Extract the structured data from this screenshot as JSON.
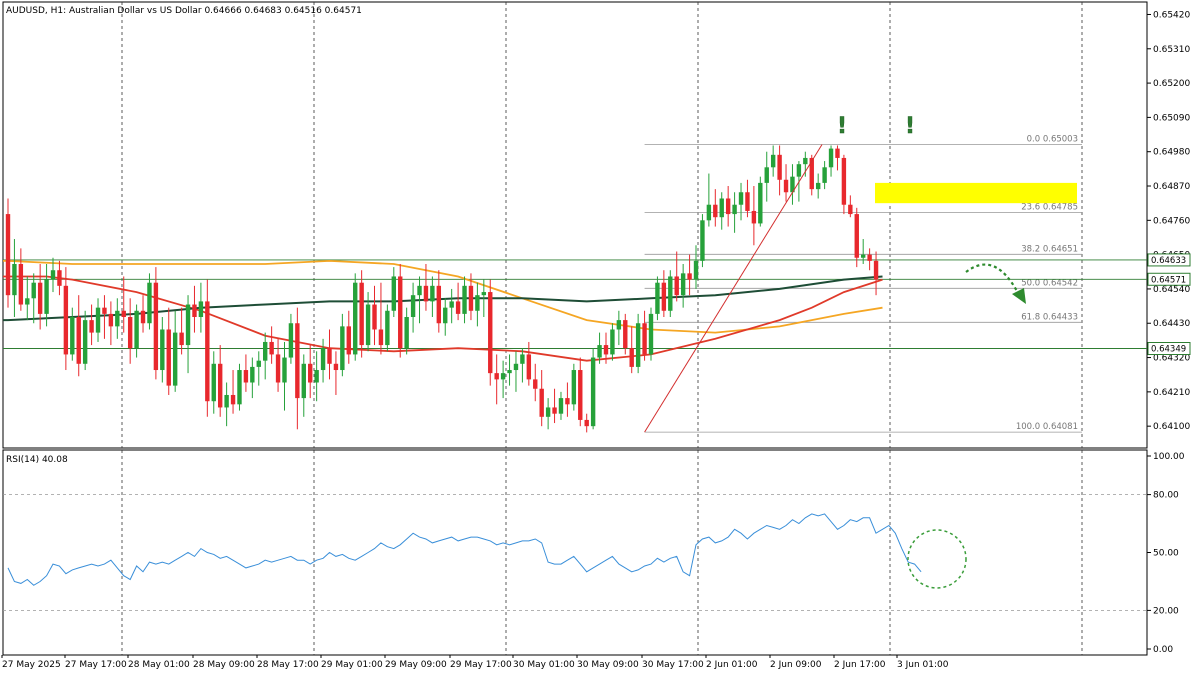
{
  "header": {
    "text": "AUDUSD, H1:  Australian Dollar vs US Dollar  0.64666 0.64683 0.64516 0.64571"
  },
  "rsi_label": "RSI(14) 40.08",
  "colors": {
    "bull": "#26a13a",
    "bear": "#e8282d",
    "ema50": "#e03a2a",
    "ema100": "#f5a623",
    "ema200": "#1e4d36",
    "rsi": "#3a8fd9",
    "fib": "#999999",
    "hline": "#2e7d32",
    "highlight": "#ffff00",
    "arrow": "#2e8b2e",
    "circle": "#3a9d3a"
  },
  "chart_data": [
    {
      "type": "candlestick",
      "symbol": "AUDUSD",
      "timeframe": "H1",
      "ylim": [
        0.6403,
        0.6546
      ],
      "y_ticks": [
        "0.65420",
        "0.65310",
        "0.65200",
        "0.65090",
        "0.64980",
        "0.64870",
        "0.64760",
        "0.64650",
        "0.64540",
        "0.64430",
        "0.64320",
        "0.64210",
        "0.64100"
      ],
      "x_ticks": [
        "27 May 2025",
        "27 May 17:00",
        "28 May 01:00",
        "28 May 09:00",
        "28 May 17:00",
        "29 May 01:00",
        "29 May 09:00",
        "29 May 17:00",
        "30 May 01:00",
        "30 May 09:00",
        "30 May 17:00",
        "2 Jun 01:00",
        "2 Jun 09:00",
        "2 Jun 17:00",
        "3 Jun 01:00"
      ],
      "price_tags": [
        {
          "label": "0.64633",
          "value": 0.64633
        },
        {
          "label": "0.64571",
          "value": 0.64571
        },
        {
          "label": "0.64349",
          "value": 0.64349
        }
      ],
      "horizontal_lines": [
        0.64633,
        0.64571,
        0.64349
      ],
      "fibonacci": {
        "from": 0.64081,
        "to": 0.65003,
        "levels": [
          {
            "label": "0.0 0.65003",
            "value": 0.65003
          },
          {
            "label": "23.6 0.64785",
            "value": 0.64785
          },
          {
            "label": "38.2 0.64651",
            "value": 0.64651
          },
          {
            "label": "50.0 0.64542",
            "value": 0.64542
          },
          {
            "label": "61.8 0.64433",
            "value": 0.64433
          },
          {
            "label": "100.0 0.64081",
            "value": 0.64081
          }
        ]
      },
      "highlight_zone": [
        0.64815,
        0.6488
      ],
      "annotations": [
        "!",
        "!"
      ],
      "candles": [
        [
          0.6478,
          0.6483,
          0.6448,
          0.6452
        ],
        [
          0.6452,
          0.647,
          0.6445,
          0.6462
        ],
        [
          0.6462,
          0.6467,
          0.6447,
          0.6449
        ],
        [
          0.6449,
          0.6458,
          0.6444,
          0.6451
        ],
        [
          0.6451,
          0.6459,
          0.6443,
          0.6456
        ],
        [
          0.6456,
          0.6462,
          0.6441,
          0.6446
        ],
        [
          0.6446,
          0.6462,
          0.6442,
          0.6457
        ],
        [
          0.6457,
          0.6464,
          0.6453,
          0.646
        ],
        [
          0.646,
          0.6463,
          0.6452,
          0.6455
        ],
        [
          0.6455,
          0.6461,
          0.6428,
          0.6433
        ],
        [
          0.6433,
          0.6448,
          0.6431,
          0.6445
        ],
        [
          0.6445,
          0.6452,
          0.6426,
          0.643
        ],
        [
          0.643,
          0.6447,
          0.6428,
          0.6444
        ],
        [
          0.6444,
          0.6449,
          0.6436,
          0.644
        ],
        [
          0.644,
          0.6451,
          0.6437,
          0.6448
        ],
        [
          0.6448,
          0.6452,
          0.6438,
          0.6446
        ],
        [
          0.6446,
          0.645,
          0.6436,
          0.6442
        ],
        [
          0.6442,
          0.6451,
          0.6438,
          0.6447
        ],
        [
          0.6447,
          0.6458,
          0.644,
          0.6445
        ],
        [
          0.6445,
          0.6451,
          0.643,
          0.6435
        ],
        [
          0.6435,
          0.6449,
          0.6432,
          0.6447
        ],
        [
          0.6447,
          0.6452,
          0.644,
          0.6443
        ],
        [
          0.6443,
          0.6459,
          0.6441,
          0.6456
        ],
        [
          0.6456,
          0.6461,
          0.6425,
          0.6428
        ],
        [
          0.6428,
          0.6445,
          0.6424,
          0.6441
        ],
        [
          0.6441,
          0.6448,
          0.642,
          0.6423
        ],
        [
          0.6423,
          0.6447,
          0.6421,
          0.644
        ],
        [
          0.644,
          0.6448,
          0.6433,
          0.6436
        ],
        [
          0.6436,
          0.6452,
          0.6427,
          0.6449
        ],
        [
          0.6449,
          0.6455,
          0.644,
          0.6445
        ],
        [
          0.6445,
          0.6456,
          0.644,
          0.645
        ],
        [
          0.645,
          0.6457,
          0.6413,
          0.6418
        ],
        [
          0.6418,
          0.6434,
          0.6414,
          0.643
        ],
        [
          0.643,
          0.6436,
          0.6413,
          0.6416
        ],
        [
          0.6416,
          0.6424,
          0.641,
          0.642
        ],
        [
          0.642,
          0.6428,
          0.6414,
          0.6417
        ],
        [
          0.6417,
          0.643,
          0.6415,
          0.6428
        ],
        [
          0.6428,
          0.6433,
          0.6421,
          0.6424
        ],
        [
          0.6424,
          0.6432,
          0.6419,
          0.6429
        ],
        [
          0.6429,
          0.6434,
          0.6423,
          0.6431
        ],
        [
          0.6431,
          0.644,
          0.6425,
          0.6437
        ],
        [
          0.6437,
          0.6442,
          0.643,
          0.6433
        ],
        [
          0.6433,
          0.6438,
          0.6421,
          0.6424
        ],
        [
          0.6424,
          0.6437,
          0.6415,
          0.6432
        ],
        [
          0.6432,
          0.6446,
          0.643,
          0.6443
        ],
        [
          0.6443,
          0.6448,
          0.6409,
          0.6419
        ],
        [
          0.6419,
          0.6433,
          0.6413,
          0.643
        ],
        [
          0.643,
          0.6436,
          0.6419,
          0.6424
        ],
        [
          0.6424,
          0.6434,
          0.6418,
          0.6428
        ],
        [
          0.6428,
          0.6438,
          0.6424,
          0.6435
        ],
        [
          0.6435,
          0.6441,
          0.6425,
          0.643
        ],
        [
          0.643,
          0.6434,
          0.642,
          0.6428
        ],
        [
          0.6428,
          0.6446,
          0.6426,
          0.6442
        ],
        [
          0.6442,
          0.6447,
          0.643,
          0.6433
        ],
        [
          0.6433,
          0.6459,
          0.6431,
          0.6456
        ],
        [
          0.6456,
          0.646,
          0.6432,
          0.6436
        ],
        [
          0.6436,
          0.6453,
          0.6434,
          0.6449
        ],
        [
          0.6449,
          0.6455,
          0.6436,
          0.6441
        ],
        [
          0.6441,
          0.6456,
          0.6433,
          0.6436
        ],
        [
          0.6436,
          0.6449,
          0.6434,
          0.6447
        ],
        [
          0.6447,
          0.6461,
          0.6445,
          0.6458
        ],
        [
          0.6458,
          0.6462,
          0.6432,
          0.6435
        ],
        [
          0.6435,
          0.6448,
          0.6433,
          0.6445
        ],
        [
          0.6445,
          0.6456,
          0.644,
          0.6452
        ],
        [
          0.6452,
          0.6458,
          0.6443,
          0.6455
        ],
        [
          0.6455,
          0.6462,
          0.6447,
          0.645
        ],
        [
          0.645,
          0.6458,
          0.6445,
          0.6455
        ],
        [
          0.6455,
          0.646,
          0.644,
          0.6443
        ],
        [
          0.6443,
          0.6451,
          0.6439,
          0.6448
        ],
        [
          0.6448,
          0.6454,
          0.6443,
          0.645
        ],
        [
          0.645,
          0.6456,
          0.6444,
          0.6446
        ],
        [
          0.6446,
          0.6458,
          0.6443,
          0.6455
        ],
        [
          0.6455,
          0.6459,
          0.6444,
          0.6447
        ],
        [
          0.6447,
          0.6456,
          0.6442,
          0.6452
        ],
        [
          0.6452,
          0.6457,
          0.6445,
          0.6453
        ],
        [
          0.6453,
          0.6457,
          0.6423,
          0.6427
        ],
        [
          0.6427,
          0.6433,
          0.6417,
          0.6425
        ],
        [
          0.6425,
          0.6431,
          0.6419,
          0.6427
        ],
        [
          0.6427,
          0.6433,
          0.6423,
          0.6428
        ],
        [
          0.6428,
          0.6434,
          0.6421,
          0.643
        ],
        [
          0.643,
          0.6435,
          0.6424,
          0.6433
        ],
        [
          0.6433,
          0.6437,
          0.6423,
          0.6425
        ],
        [
          0.6425,
          0.643,
          0.6418,
          0.6422
        ],
        [
          0.6422,
          0.6428,
          0.641,
          0.6413
        ],
        [
          0.6413,
          0.6419,
          0.6409,
          0.6416
        ],
        [
          0.6416,
          0.6422,
          0.6411,
          0.6414
        ],
        [
          0.6414,
          0.6421,
          0.6412,
          0.6419
        ],
        [
          0.6419,
          0.6424,
          0.6413,
          0.6417
        ],
        [
          0.6417,
          0.643,
          0.6415,
          0.6428
        ],
        [
          0.6428,
          0.6432,
          0.641,
          0.6412
        ],
        [
          0.6412,
          0.6414,
          0.6408,
          0.641
        ],
        [
          0.641,
          0.6435,
          0.6409,
          0.6432
        ],
        [
          0.6432,
          0.644,
          0.643,
          0.6436
        ],
        [
          0.6436,
          0.644,
          0.643,
          0.6433
        ],
        [
          0.6433,
          0.6443,
          0.6431,
          0.6441
        ],
        [
          0.6441,
          0.6447,
          0.6436,
          0.6444
        ],
        [
          0.6444,
          0.6446,
          0.6433,
          0.6435
        ],
        [
          0.6435,
          0.6442,
          0.6427,
          0.6429
        ],
        [
          0.6429,
          0.6446,
          0.6427,
          0.6443
        ],
        [
          0.6443,
          0.6447,
          0.6431,
          0.6433
        ],
        [
          0.6433,
          0.6448,
          0.6431,
          0.6446
        ],
        [
          0.6446,
          0.6458,
          0.6444,
          0.6456
        ],
        [
          0.6456,
          0.646,
          0.6445,
          0.6447
        ],
        [
          0.6447,
          0.646,
          0.6445,
          0.6458
        ],
        [
          0.6458,
          0.6466,
          0.645,
          0.6452
        ],
        [
          0.6452,
          0.6462,
          0.6448,
          0.6459
        ],
        [
          0.6459,
          0.6465,
          0.6452,
          0.6457
        ],
        [
          0.6457,
          0.6468,
          0.6454,
          0.6463
        ],
        [
          0.6463,
          0.6478,
          0.6461,
          0.6476
        ],
        [
          0.6476,
          0.6491,
          0.6474,
          0.6481
        ],
        [
          0.6481,
          0.6486,
          0.6474,
          0.6477
        ],
        [
          0.6477,
          0.6485,
          0.6473,
          0.6483
        ],
        [
          0.6483,
          0.6487,
          0.6474,
          0.6478
        ],
        [
          0.6478,
          0.6485,
          0.6472,
          0.6481
        ],
        [
          0.6481,
          0.6488,
          0.6476,
          0.6485
        ],
        [
          0.6485,
          0.6489,
          0.6477,
          0.6479
        ],
        [
          0.6479,
          0.6487,
          0.6468,
          0.6475
        ],
        [
          0.6475,
          0.649,
          0.6474,
          0.6488
        ],
        [
          0.6488,
          0.6498,
          0.6482,
          0.6493
        ],
        [
          0.6493,
          0.65,
          0.649,
          0.6497
        ],
        [
          0.6497,
          0.65,
          0.6484,
          0.6489
        ],
        [
          0.6489,
          0.6494,
          0.6482,
          0.6485
        ],
        [
          0.6485,
          0.6494,
          0.6481,
          0.649
        ],
        [
          0.649,
          0.6495,
          0.6482,
          0.6494
        ],
        [
          0.6494,
          0.6498,
          0.649,
          0.6496
        ],
        [
          0.6496,
          0.6497,
          0.6484,
          0.6486
        ],
        [
          0.6486,
          0.6491,
          0.6483,
          0.6488
        ],
        [
          0.6488,
          0.6495,
          0.6486,
          0.6493
        ],
        [
          0.6493,
          0.65,
          0.649,
          0.6499
        ],
        [
          0.6499,
          0.65,
          0.6492,
          0.6496
        ],
        [
          0.6496,
          0.6497,
          0.6478,
          0.6481
        ],
        [
          0.6481,
          0.6484,
          0.6477,
          0.6478
        ],
        [
          0.6478,
          0.648,
          0.6461,
          0.6464
        ],
        [
          0.6464,
          0.647,
          0.6462,
          0.6465
        ],
        [
          0.6465,
          0.6467,
          0.646,
          0.6463
        ],
        [
          0.6463,
          0.6466,
          0.6452,
          0.6457
        ]
      ],
      "ema50": {
        "x": [
          0,
          6,
          10,
          20,
          30,
          40,
          50,
          60,
          70,
          80,
          90,
          100,
          110,
          120,
          125,
          130,
          136
        ],
        "y": [
          0.6458,
          0.6458,
          0.6457,
          0.6453,
          0.6447,
          0.6439,
          0.6435,
          0.6434,
          0.6435,
          0.6434,
          0.6431,
          0.6433,
          0.6438,
          0.6444,
          0.6448,
          0.6453,
          0.6457
        ]
      },
      "ema100": {
        "x": [
          0,
          10,
          20,
          30,
          40,
          50,
          60,
          70,
          80,
          90,
          100,
          110,
          120,
          130,
          136
        ],
        "y": [
          0.6463,
          0.6462,
          0.6462,
          0.6462,
          0.6462,
          0.6463,
          0.6462,
          0.6458,
          0.6451,
          0.6444,
          0.6441,
          0.644,
          0.6442,
          0.6446,
          0.6448
        ]
      },
      "ema200": {
        "x": [
          0,
          10,
          20,
          30,
          40,
          50,
          60,
          70,
          80,
          90,
          100,
          110,
          120,
          130,
          136
        ],
        "y": [
          0.6444,
          0.6445,
          0.6446,
          0.6448,
          0.6449,
          0.645,
          0.645,
          0.6451,
          0.6451,
          0.645,
          0.6451,
          0.6452,
          0.6454,
          0.6457,
          0.6458
        ]
      }
    },
    {
      "type": "line",
      "name": "RSI(14)",
      "ylim": [
        0,
        100
      ],
      "y_ticks": [
        "100.00",
        "80.00",
        "50.00",
        "20.00",
        "0.00"
      ],
      "levels": [
        80,
        20
      ],
      "values": [
        42,
        35,
        34,
        36,
        33,
        35,
        38,
        44,
        43,
        39,
        41,
        42,
        43,
        44,
        43,
        44,
        46,
        42,
        38,
        36,
        43,
        40,
        45,
        44,
        45,
        44,
        46,
        48,
        50,
        48,
        52,
        50,
        49,
        47,
        48,
        46,
        44,
        42,
        43,
        44,
        46,
        45,
        46,
        47,
        48,
        46,
        46,
        44,
        46,
        47,
        50,
        48,
        49,
        47,
        46,
        48,
        50,
        52,
        55,
        53,
        52,
        54,
        57,
        60,
        58,
        57,
        55,
        56,
        57,
        58,
        56,
        57,
        58,
        58,
        57,
        56,
        54,
        55,
        54,
        55,
        56,
        56,
        57,
        55,
        45,
        44,
        44,
        46,
        48,
        44,
        40,
        42,
        44,
        46,
        48,
        44,
        42,
        40,
        41,
        43,
        44,
        47,
        45,
        47,
        48,
        40,
        38,
        54,
        57,
        58,
        55,
        56,
        58,
        62,
        60,
        57,
        60,
        62,
        64,
        63,
        62,
        64,
        67,
        65,
        68,
        70,
        69,
        70,
        66,
        62,
        64,
        67,
        66,
        68,
        68,
        60,
        62,
        64,
        60,
        52,
        45,
        44,
        40
      ]
    }
  ]
}
